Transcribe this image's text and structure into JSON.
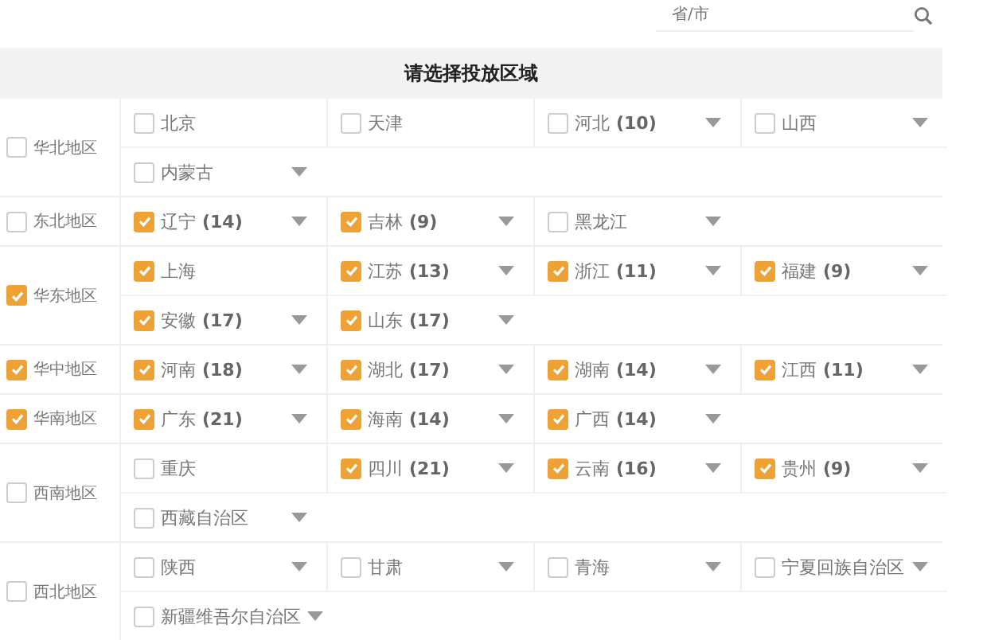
{
  "search": {
    "placeholder": "省/市"
  },
  "title": "请选择投放区域",
  "regions": [
    {
      "name": "华北地区",
      "checked": false,
      "rows": [
        {
          "provinces": [
            {
              "name": "北京",
              "checked": false,
              "dropdown": false
            },
            {
              "name": "天津",
              "checked": false,
              "dropdown": false
            },
            {
              "name": "河北",
              "count": "(10)",
              "checked": false,
              "dropdown": true
            },
            {
              "name": "山西",
              "checked": false,
              "dropdown": true
            }
          ]
        },
        {
          "provinces": [
            {
              "name": "内蒙古",
              "checked": false,
              "dropdown": true
            }
          ]
        }
      ]
    },
    {
      "name": "东北地区",
      "checked": false,
      "rows": [
        {
          "provinces": [
            {
              "name": "辽宁",
              "count": "(14)",
              "checked": true,
              "dropdown": true
            },
            {
              "name": "吉林",
              "count": "(9)",
              "checked": true,
              "dropdown": true
            },
            {
              "name": "黑龙江",
              "checked": false,
              "dropdown": true
            }
          ]
        }
      ]
    },
    {
      "name": "华东地区",
      "checked": true,
      "rows": [
        {
          "provinces": [
            {
              "name": "上海",
              "checked": true,
              "dropdown": false
            },
            {
              "name": "江苏",
              "count": "(13)",
              "checked": true,
              "dropdown": true
            },
            {
              "name": "浙江",
              "count": "(11)",
              "checked": true,
              "dropdown": true
            },
            {
              "name": "福建",
              "count": "(9)",
              "checked": true,
              "dropdown": true
            }
          ]
        },
        {
          "provinces": [
            {
              "name": "安徽",
              "count": "(17)",
              "checked": true,
              "dropdown": true
            },
            {
              "name": "山东",
              "count": "(17)",
              "checked": true,
              "dropdown": true
            }
          ]
        }
      ]
    },
    {
      "name": "华中地区",
      "checked": true,
      "rows": [
        {
          "provinces": [
            {
              "name": "河南",
              "count": "(18)",
              "checked": true,
              "dropdown": true
            },
            {
              "name": "湖北",
              "count": "(17)",
              "checked": true,
              "dropdown": true
            },
            {
              "name": "湖南",
              "count": "(14)",
              "checked": true,
              "dropdown": true
            },
            {
              "name": "江西",
              "count": "(11)",
              "checked": true,
              "dropdown": true
            }
          ]
        }
      ]
    },
    {
      "name": "华南地区",
      "checked": true,
      "rows": [
        {
          "provinces": [
            {
              "name": "广东",
              "count": "(21)",
              "checked": true,
              "dropdown": true
            },
            {
              "name": "海南",
              "count": "(14)",
              "checked": true,
              "dropdown": true
            },
            {
              "name": "广西",
              "count": "(14)",
              "checked": true,
              "dropdown": true
            }
          ]
        }
      ]
    },
    {
      "name": "西南地区",
      "checked": false,
      "rows": [
        {
          "provinces": [
            {
              "name": "重庆",
              "checked": false,
              "dropdown": false
            },
            {
              "name": "四川",
              "count": "(21)",
              "checked": true,
              "dropdown": true
            },
            {
              "name": "云南",
              "count": "(16)",
              "checked": true,
              "dropdown": true
            },
            {
              "name": "贵州",
              "count": "(9)",
              "checked": true,
              "dropdown": true
            }
          ]
        },
        {
          "provinces": [
            {
              "name": "西藏自治区",
              "checked": false,
              "dropdown": true
            }
          ]
        }
      ]
    },
    {
      "name": "西北地区",
      "checked": false,
      "rows": [
        {
          "provinces": [
            {
              "name": "陕西",
              "checked": false,
              "dropdown": true
            },
            {
              "name": "甘肃",
              "checked": false,
              "dropdown": true
            },
            {
              "name": "青海",
              "checked": false,
              "dropdown": true
            },
            {
              "name": "宁夏回族自治区",
              "checked": false,
              "dropdown": true
            }
          ]
        },
        {
          "provinces": [
            {
              "name": "新疆维吾尔自治区",
              "checked": false,
              "dropdown": true
            }
          ]
        }
      ]
    }
  ]
}
